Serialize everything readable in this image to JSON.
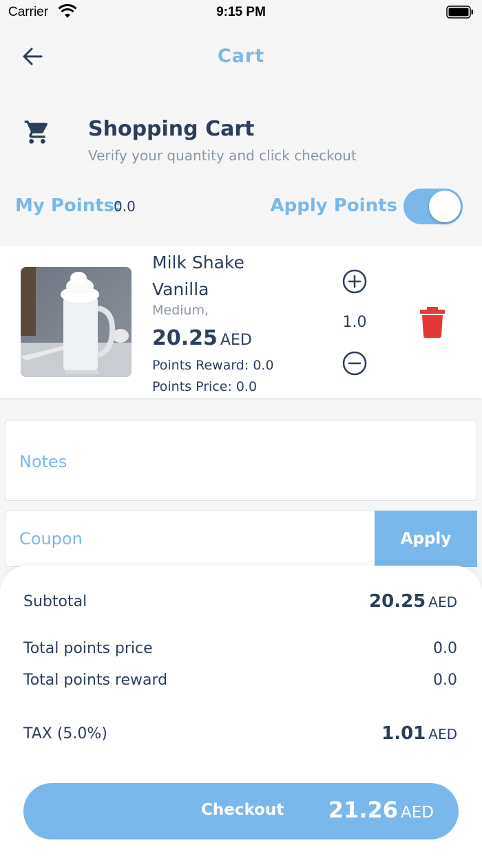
{
  "status_bar": {
    "carrier": "Carrier",
    "time": "9:15 PM"
  },
  "nav": {
    "title": "Cart"
  },
  "header": {
    "title": "Shopping Cart",
    "subtitle": "Verify your quantity and click checkout"
  },
  "points": {
    "my_points_label": "My Points:",
    "my_points_value": "0.0",
    "apply_points_label": "Apply Points",
    "apply_points_enabled": true
  },
  "cart_item": {
    "name": "Milk Shake Vanilla",
    "size": "Medium,",
    "price": "20.25",
    "currency": "AED",
    "points_reward": "Points Reward: 0.0",
    "points_price": "Points Price: 0.0",
    "quantity": "1.0"
  },
  "notes": {
    "placeholder": "Notes"
  },
  "coupon": {
    "placeholder": "Coupon",
    "apply_label": "Apply"
  },
  "summary": {
    "subtotal_label": "Subtotal",
    "subtotal_value": "20.25",
    "subtotal_currency": "AED",
    "total_points_price_label": "Total points price",
    "total_points_price_value": "0.0",
    "total_points_reward_label": "Total points reward",
    "total_points_reward_value": "0.0",
    "tax_label": "TAX (5.0%)",
    "tax_value": "1.01",
    "tax_currency": "AED"
  },
  "checkout": {
    "label": "Checkout",
    "total": "21.26",
    "currency": "AED"
  },
  "colors": {
    "accent": "#7ab8ec",
    "text": "#2c3e5a",
    "muted": "#8a96a6",
    "danger": "#e53935",
    "background": "#f6f6f6"
  },
  "icons": [
    "wifi-icon",
    "battery-icon",
    "back-arrow-icon",
    "cart-icon",
    "plus-circle-icon",
    "minus-circle-icon",
    "trash-icon"
  ]
}
